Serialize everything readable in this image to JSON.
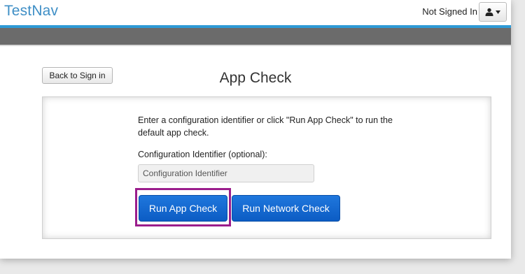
{
  "header": {
    "brand": "TestNav",
    "signin_status": "Not Signed In",
    "user_menu_icon": "user-icon",
    "user_menu_caret": "chevron-down-icon"
  },
  "colors": {
    "brand": "#3f8fc6",
    "accent_line": "#2e9ad6",
    "band": "#6b6b6b",
    "primary_button": "#1a6fd6",
    "highlight": "#9b1d8c"
  },
  "page": {
    "back_label": "Back to Sign in",
    "title": "App Check"
  },
  "form": {
    "instructions": "Enter a configuration identifier or click \"Run App Check\" to run the default app check.",
    "field_label": "Configuration Identifier (optional):",
    "field_placeholder": "Configuration Identifier",
    "field_value": "",
    "run_app_check_label": "Run App Check",
    "run_network_check_label": "Run Network Check"
  }
}
